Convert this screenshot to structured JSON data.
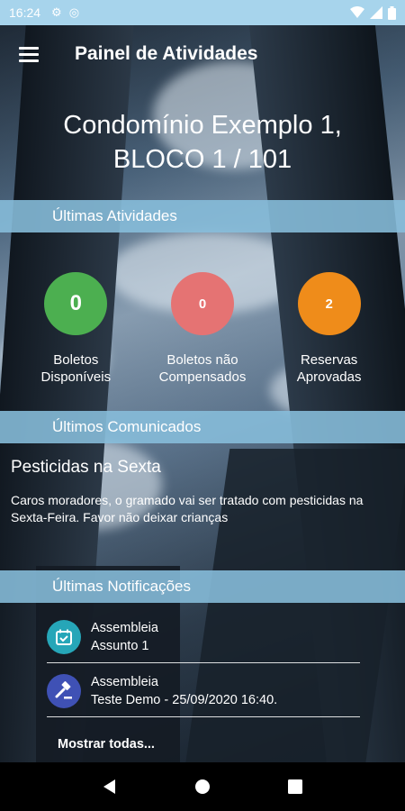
{
  "status_bar": {
    "time": "16:24"
  },
  "app_bar": {
    "title": "Painel de Atividades"
  },
  "condo": {
    "line1": "Condomínio Exemplo 1,",
    "line2": "BLOCO 1 / 101"
  },
  "sections": {
    "activities": "Últimas Atividades",
    "announcements": "Últimos Comunicados",
    "notifications": "Últimas Notificações"
  },
  "stats": [
    {
      "value": "0",
      "label_line1": "Boletos",
      "label_line2": "Disponíveis",
      "color": "#4caf50"
    },
    {
      "value": "0",
      "label_line1": "Boletos não",
      "label_line2": "Compensados",
      "color": "#e57373"
    },
    {
      "value": "2",
      "label_line1": "Reservas",
      "label_line2": "Aprovadas",
      "color": "#ef8c1a"
    }
  ],
  "announcement": {
    "title": "Pesticidas na Sexta",
    "body": "Caros moradores, o gramado vai ser tratado com pesticidas na Sexta-Feira. Favor não deixar crianças"
  },
  "notifications": [
    {
      "title": "Assembleia",
      "subtitle": "Assunto 1",
      "icon": "calendar-check-icon",
      "color": "#26a6b8"
    },
    {
      "title": "Assembleia",
      "subtitle": "Teste Demo - 25/09/2020 16:40.",
      "icon": "gavel-icon",
      "color": "#3f51b5"
    }
  ],
  "show_all": "Mostrar todas..."
}
